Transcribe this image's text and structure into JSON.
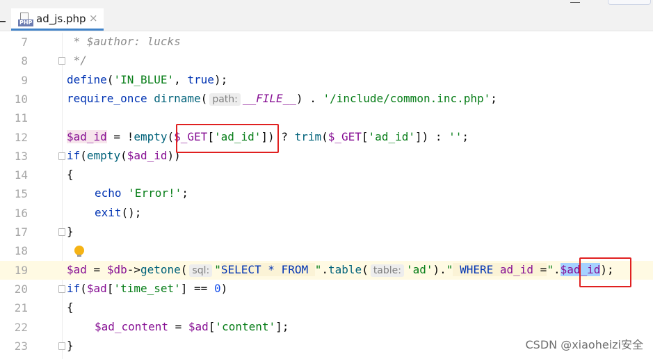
{
  "tab": {
    "label": "ad_js.php",
    "badge": "PHP",
    "close": "×"
  },
  "lines": {
    "l7": {
      "num": "7",
      "content": " * $author: lucks"
    },
    "l8": {
      "num": "8",
      "content": " */"
    },
    "l9": {
      "num": "9",
      "kw": "define",
      "p1": "(",
      "str": "'IN_BLUE'",
      "p2": ", ",
      "b": "true",
      "p3": ");"
    },
    "l10": {
      "num": "10",
      "kw": "require_once",
      "fn": "dirname",
      "p1": "(",
      "hint": "path:",
      "cst": "__FILE__",
      "p2": ") . ",
      "str": "'/include/common.inc.php'",
      "p3": ";"
    },
    "l11": {
      "num": "11"
    },
    "l12": {
      "num": "12",
      "var1": "$ad_id",
      "t1": " = !",
      "fn1": "empty",
      "t2": "(",
      "var2": "$_GET",
      "t3": "[",
      "str1": "'ad_id'",
      "t4": "]) ? ",
      "fn2": "trim",
      "t5": "(",
      "var3": "$_GET",
      "t6": "[",
      "str2": "'ad_id'",
      "t7": "]) : ",
      "str3": "''",
      "t8": ";"
    },
    "l13": {
      "num": "13",
      "kw": "if",
      "t1": "(",
      "fn": "empty",
      "t2": "(",
      "var": "$ad_id",
      "t3": "))"
    },
    "l14": {
      "num": "14",
      "content": "{"
    },
    "l15": {
      "num": "15",
      "kw": "echo",
      "str": "'Error!'",
      "t": ";"
    },
    "l16": {
      "num": "16",
      "kw": "exit",
      "t": "();"
    },
    "l17": {
      "num": "17",
      "content": "}"
    },
    "l18": {
      "num": "18"
    },
    "l19": {
      "num": "19",
      "var1": "$ad",
      "t1": " = ",
      "var2": "$db",
      "t2": "->",
      "fn1": "getone",
      "t3": "(",
      "hint1": "sql:",
      "q1": "\"",
      "sql1": "SELECT * FROM ",
      "q2": "\"",
      "t4": ".",
      "fn2": "table",
      "t5": "(",
      "hint2": "table:",
      "str1": "'ad'",
      "t6": ").",
      "q3": "\"",
      "sql2": " WHERE ",
      "sqlcol": "ad_id",
      "sql3": " =",
      "q4": "\"",
      "t7": ".",
      "var3": "$ad_id",
      "t8": ");"
    },
    "l20": {
      "num": "20",
      "kw": "if",
      "t1": "(",
      "var": "$ad",
      "t2": "[",
      "str": "'time_set'",
      "t3": "] == ",
      "n": "0",
      "t4": ")"
    },
    "l21": {
      "num": "21",
      "content": "{"
    },
    "l22": {
      "num": "22",
      "var1": "$ad_content",
      "t1": " = ",
      "var2": "$ad",
      "t2": "[",
      "str": "'content'",
      "t3": "];"
    },
    "l23": {
      "num": "23",
      "content": "}"
    }
  },
  "watermark": "CSDN @xiaoheizi安全",
  "colors": {
    "highlight_box": "#e02020",
    "current_line": "#fffae3",
    "selection": "#a6d2ff",
    "tab_underline": "#4083c9"
  }
}
